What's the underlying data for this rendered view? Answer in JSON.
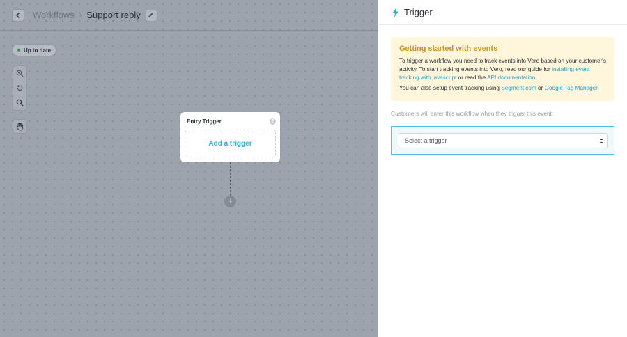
{
  "breadcrumb": {
    "parent": "Workflows",
    "separator": "›",
    "title": "Support reply"
  },
  "status": {
    "label": "Up to date",
    "color": "#3f9b52"
  },
  "canvas": {
    "tools": [
      "zoom-in-icon",
      "reset-icon",
      "zoom-out-icon",
      "hand-icon"
    ],
    "entry_node": {
      "title": "Entry Trigger",
      "help": "?",
      "action": "Add a trigger"
    },
    "add_step": "+"
  },
  "panel": {
    "title": "Trigger",
    "icon": "lightning-icon",
    "accent": "#2bb0d7",
    "info": {
      "heading": "Getting started with events",
      "p1_text1": "To trigger a workflow you need to track events into Vero based on your customer's activity. To start tracking events into Vero, read our guide for ",
      "p1_link1": "installing event tracking with javascript",
      "p1_text2": " or read the ",
      "p1_link2": "API documentation",
      "p1_text3": ".",
      "p2_text1": "You can also setup event tracking using ",
      "p2_link1": "Segment.com",
      "p2_text2": " or ",
      "p2_link2": "Google Tag Manager",
      "p2_text3": "."
    },
    "enter_label": "Customers will enter this workflow when they trigger this event:",
    "select_placeholder": "Select a trigger"
  }
}
